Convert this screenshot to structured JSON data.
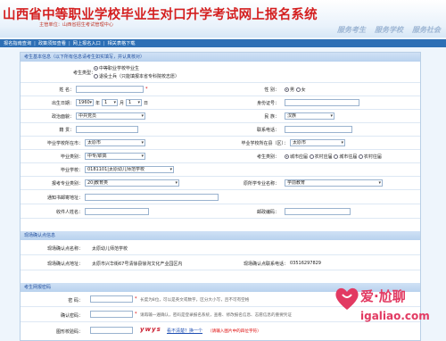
{
  "header": {
    "title": "山西省中等职业学校毕业生对口升学考试网上报名系统",
    "subtitle": "主管单位：山西省招生考试管理中心",
    "slogans": [
      "服务考生",
      "服务学校",
      "服务社会"
    ]
  },
  "nav": {
    "items": [
      "报名指南查询",
      "政策须知查看",
      "网上报名入口",
      "相关表格下载"
    ]
  },
  "sections": {
    "basic": "考生基本信息（以下所有信息请考生如实填写，并认真核对）",
    "site": "现场确认点信息",
    "password": "考生网报密码"
  },
  "form": {
    "exam_type_label": "考生类型：",
    "exam_type_opt1": "中等职业学校毕业生",
    "exam_type_opt2": "退役士兵（只能填报本省专科院校志愿）",
    "name_label": "姓  名：",
    "gender_label": "性  别：",
    "gender_male": "男",
    "gender_female": "女",
    "birth_label": "出生日期：",
    "birth_year": "1960",
    "birth_year_unit": "年",
    "birth_month": "1",
    "birth_month_unit": "月",
    "birth_day": "1",
    "birth_day_unit": "日",
    "id_label": "身份证号：",
    "politics_label": "政治面貌：",
    "politics_value": "中共党员",
    "ethnic_label": "民  族：",
    "ethnic_value": "汉族",
    "origin_label": "籍  贯：",
    "phone_label": "联系电话：",
    "grad_city_label": "毕业学校所在市：",
    "grad_city_value": "太原市",
    "grad_county_label": "毕业学校所在县（区）：",
    "grad_county_value": "太原市",
    "grad_type_label": "毕业类别：",
    "grad_type_value": "中专/职高",
    "hukou_label": "考生类别：",
    "hukou_opts": [
      "城市应届",
      "农村应届",
      "城市往届",
      "农村往届"
    ],
    "school_label": "毕业学校：",
    "school_value": "0181101|太原幼儿师范学校",
    "major_cat_label": "报考专业类别：",
    "major_cat_value": "20|教育类",
    "orig_major_label": "原所学专业名称：",
    "orig_major_value": "学前教育",
    "address_label": "通知书邮寄地址：",
    "recipient_label": "收件人姓名：",
    "postcode_label": "邮政编码：",
    "site_name_label": "现场确认点名称：",
    "site_name_value": "太原幼儿师范学校",
    "site_addr_label": "现场确认点地址：",
    "site_addr_value": "太原市兴华街67号清徐县徐沟文化产业园区内",
    "site_phone_label": "现场确认点联系电话：",
    "site_phone_value": "03516297829",
    "pwd_label": "密  码：",
    "pwd_note": "长度为8位，可以是英文或数字，区分大小写，且不可有空格",
    "pwd2_label": "确认密码：",
    "pwd2_note": "请再输一遍确认，密码是登录报名系统，查看、修改报名信息、志愿信息的重要凭证",
    "captcha_label": "图形校验码：",
    "captcha_text": "ywys",
    "captcha_refresh": "看不清楚？换一个",
    "captcha_note": "（请输入图片中的四位字符）"
  },
  "watermark": {
    "text": "爱·尬聊",
    "url": "igaliao.com"
  },
  "colors": {
    "title_red": "#d41f1f",
    "nav_blue": "#2d6fb5",
    "section_bg": "#c6dbf2",
    "watermark_pink": "#e23a62"
  }
}
